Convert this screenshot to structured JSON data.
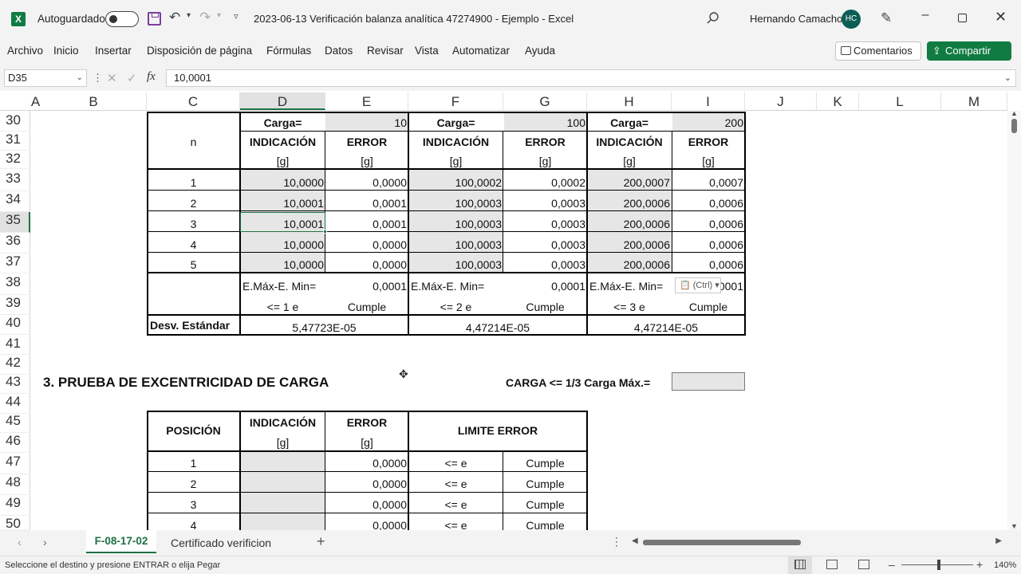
{
  "titlebar": {
    "app_icon_letter": "X",
    "autosave_label": "Autoguardado",
    "doc_title": "2023-06-13 Verificación balanza analítica 47274900 - Ejemplo  -  Excel",
    "user_name": "Hernando Camacho",
    "user_initials": "HC"
  },
  "menu": {
    "items": [
      "Archivo",
      "Inicio",
      "Insertar",
      "Disposición de página",
      "Fórmulas",
      "Datos",
      "Revisar",
      "Vista",
      "Automatizar",
      "Ayuda"
    ],
    "comments_label": "Comentarios",
    "share_label": "Compartir"
  },
  "formula_bar": {
    "name_box": "D35",
    "fx_symbol": "fx",
    "value": "10,0001"
  },
  "columns": [
    "A",
    "B",
    "C",
    "D",
    "E",
    "F",
    "G",
    "H",
    "I",
    "J",
    "K",
    "L",
    "M"
  ],
  "rows": [
    "30",
    "31",
    "32",
    "33",
    "34",
    "35",
    "36",
    "37",
    "38",
    "39",
    "40",
    "41",
    "42",
    "43",
    "44",
    "45",
    "46",
    "47",
    "48",
    "49",
    "50"
  ],
  "table1": {
    "carga_label": "Carga=",
    "carga_values": [
      "10",
      "100",
      "200"
    ],
    "n_label": "n",
    "indicacion_label": "INDICACIÓN",
    "error_label": "ERROR",
    "unit_label": "[g]",
    "rows": [
      {
        "n": "1",
        "d": "10,0000",
        "e": "0,0000",
        "f": "100,0002",
        "g": "0,0002",
        "h": "200,0007",
        "i": "0,0007"
      },
      {
        "n": "2",
        "d": "10,0001",
        "e": "0,0001",
        "f": "100,0003",
        "g": "0,0003",
        "h": "200,0006",
        "i": "0,0006"
      },
      {
        "n": "3",
        "d": "10,0001",
        "e": "0,0001",
        "f": "100,0003",
        "g": "0,0003",
        "h": "200,0006",
        "i": "0,0006"
      },
      {
        "n": "4",
        "d": "10,0000",
        "e": "0,0000",
        "f": "100,0003",
        "g": "0,0003",
        "h": "200,0006",
        "i": "0,0006"
      },
      {
        "n": "5",
        "d": "10,0000",
        "e": "0,0000",
        "f": "100,0003",
        "g": "0,0003",
        "h": "200,0006",
        "i": "0,0006"
      }
    ],
    "emax_label": "E.Máx-E. Min=",
    "emax_values": [
      "0,0001",
      "0,0001",
      "0001"
    ],
    "limits": [
      "<= 1 e",
      "<= 2 e",
      "<= 3 e"
    ],
    "cumple": "Cumple",
    "desv_label": "Desv. Estándar",
    "desv_values": [
      "5,47723E-05",
      "4,47214E-05",
      "4,47214E-05"
    ]
  },
  "paste_options": "(Ctrl)",
  "section3": {
    "title": "3. PRUEBA DE EXCENTRICIDAD DE CARGA",
    "carga_label": "CARGA <= 1/3 Carga Máx.="
  },
  "table2": {
    "posicion_label": "POSICIÓN",
    "indicacion_label": "INDICACIÓN",
    "error_label": "ERROR",
    "limite_label": "LIMITE ERROR",
    "unit_label": "[g]",
    "rows": [
      {
        "pos": "1",
        "error": "0,0000",
        "limit": "<= e",
        "result": "Cumple"
      },
      {
        "pos": "2",
        "error": "0,0000",
        "limit": "<= e",
        "result": "Cumple"
      },
      {
        "pos": "3",
        "error": "0,0000",
        "limit": "<= e",
        "result": "Cumple"
      },
      {
        "pos": "4",
        "error": "0,0000",
        "limit": "<= e",
        "result": "Cumple"
      }
    ]
  },
  "tabs": {
    "active": "F-08-17-02",
    "other": "Certificado verificion"
  },
  "status": {
    "message": "Seleccione el destino y presione ENTRAR o elija Pegar",
    "zoom": "140%"
  }
}
